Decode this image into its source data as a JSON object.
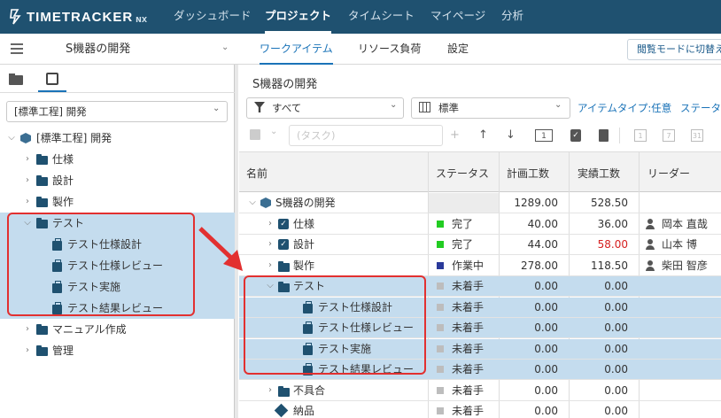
{
  "app": {
    "logo_text": "TIMETRACKER",
    "logo_suffix": "NX"
  },
  "topnav": {
    "items": [
      "ダッシュボード",
      "プロジェクト",
      "タイムシート",
      "マイページ",
      "分析"
    ]
  },
  "subbar": {
    "project": "S機器の開発",
    "tabs": [
      "ワークアイテム",
      "リソース負荷",
      "設定"
    ],
    "read_mode": "閲覧モードに切替え"
  },
  "left": {
    "template_select": "[標準工程] 開発",
    "tree": [
      {
        "label": "[標準工程] 開発",
        "kind": "root"
      },
      {
        "label": "仕様",
        "kind": "folder"
      },
      {
        "label": "設計",
        "kind": "folder"
      },
      {
        "label": "製作",
        "kind": "folder"
      },
      {
        "label": "テスト",
        "kind": "folder"
      },
      {
        "label": "テスト仕様設計",
        "kind": "task"
      },
      {
        "label": "テスト仕様レビュー",
        "kind": "task"
      },
      {
        "label": "テスト実施",
        "kind": "task"
      },
      {
        "label": "テスト結果レビュー",
        "kind": "task"
      },
      {
        "label": "マニュアル作成",
        "kind": "folder"
      },
      {
        "label": "管理",
        "kind": "folder"
      }
    ]
  },
  "right": {
    "title": "S機器の開発",
    "filter": "すべて",
    "view": "標準",
    "item_type_link": "アイテムタイプ:任意",
    "status_link": "ステータ",
    "task_placeholder": "(タスク)",
    "columns": [
      "名前",
      "ステータス",
      "計画工数",
      "実績工数",
      "リーダー"
    ],
    "rows": [
      {
        "name": "S機器の開発",
        "status": "",
        "plan": "1289.00",
        "actual": "528.50",
        "leader": "",
        "kind": "root"
      },
      {
        "name": "仕様",
        "status": "完了",
        "plan": "40.00",
        "actual": "36.00",
        "leader": "岡本 直哉",
        "kind": "check"
      },
      {
        "name": "設計",
        "status": "完了",
        "plan": "44.00",
        "actual": "58.00",
        "leader": "山本 博",
        "kind": "check"
      },
      {
        "name": "製作",
        "status": "作業中",
        "plan": "278.00",
        "actual": "118.50",
        "leader": "柴田 智彦",
        "kind": "folder"
      },
      {
        "name": "テスト",
        "status": "未着手",
        "plan": "0.00",
        "actual": "0.00",
        "leader": "",
        "kind": "folder"
      },
      {
        "name": "テスト仕様設計",
        "status": "未着手",
        "plan": "0.00",
        "actual": "0.00",
        "leader": "",
        "kind": "task"
      },
      {
        "name": "テスト仕様レビュー",
        "status": "未着手",
        "plan": "0.00",
        "actual": "0.00",
        "leader": "",
        "kind": "task"
      },
      {
        "name": "テスト実施",
        "status": "未着手",
        "plan": "0.00",
        "actual": "0.00",
        "leader": "",
        "kind": "task"
      },
      {
        "name": "テスト結果レビュー",
        "status": "未着手",
        "plan": "0.00",
        "actual": "0.00",
        "leader": "",
        "kind": "task"
      },
      {
        "name": "不具合",
        "status": "未着手",
        "plan": "0.00",
        "actual": "0.00",
        "leader": "",
        "kind": "folder"
      },
      {
        "name": "納品",
        "status": "未着手",
        "plan": "0.00",
        "actual": "0.00",
        "leader": "",
        "kind": "milestone"
      }
    ]
  },
  "colors": {
    "nav": "#1f5170",
    "accent": "#1a73b8",
    "done": "#22cc22",
    "inprogress": "#2a3a9a",
    "notstarted": "#bdbdbd",
    "over": "#d62020",
    "highlight": "#c4dcee",
    "callout": "#e23030"
  }
}
